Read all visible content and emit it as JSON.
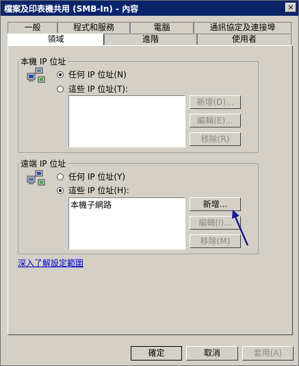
{
  "window": {
    "title": "檔案及印表機共用 (SMB-In) - 內容",
    "close_label": "×"
  },
  "tabs_row1": [
    "一般",
    "程式和服務",
    "電腦",
    "通訊協定及連接埠"
  ],
  "tabs_row2": [
    "領域",
    "進階",
    "使用者"
  ],
  "local_group": {
    "title": "本機 IP 位址",
    "option_any": "任何 IP 位址(N)",
    "option_these": "這些 IP 位址(T):",
    "selected": "any",
    "list": [],
    "add_label": "新增(D)...",
    "edit_label": "編輯(E)...",
    "remove_label": "移除(R)"
  },
  "remote_group": {
    "title": "遠端 IP 位址",
    "option_any": "任何 IP 位址(Y)",
    "option_these": "這些 IP 位址(H):",
    "selected": "these",
    "list": [
      "本機子網路"
    ],
    "add_label": "新增...",
    "edit_label": "編輯(I)...",
    "remove_label": "移除(M)"
  },
  "learn_more_link": "深入了解設定範圍",
  "footer": {
    "ok_label": "確定",
    "cancel_label": "取消",
    "apply_label": "套用(A)"
  }
}
